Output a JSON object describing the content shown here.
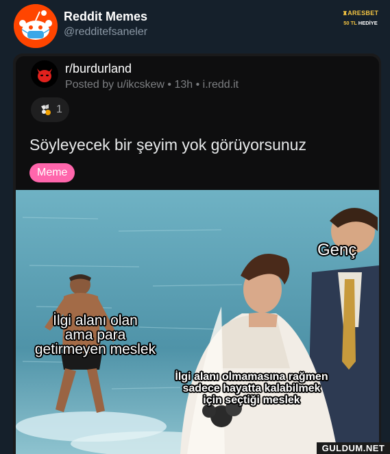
{
  "account": {
    "name": "Reddit Memes",
    "handle": "@redditefsaneler",
    "avatar_icon": "reddit-snoo-masked-icon"
  },
  "ad": {
    "brand": "ARESBET",
    "tagline_prefix": "50 TL",
    "tagline_suffix": "HEDİYE"
  },
  "post": {
    "subreddit": "r/burdurland",
    "meta": "Posted by u/ikcskew • 13h • i.redd.it",
    "award_icon": "award-icon",
    "award_count": "1",
    "title": "Söyleyecek bir şeyim yok görüyorsunuz",
    "flair": "Meme"
  },
  "meme": {
    "caption_young": "Genç",
    "caption_left_line1": "İlgi alanı olan",
    "caption_left_line2": "ama para",
    "caption_left_line3": "getirmeyen meslek",
    "caption_right_line1": "İlgi alanı olmamasına rağmen",
    "caption_right_line2": "sadece hayatta kalabilmek",
    "caption_right_line3": "için seçtiği meslek"
  },
  "watermark": "GULDUM.NET",
  "colors": {
    "background": "#15202b",
    "reddit_orange": "#ff4500",
    "flair_pink": "#ff66ac",
    "ad_gold": "#f5c542"
  }
}
